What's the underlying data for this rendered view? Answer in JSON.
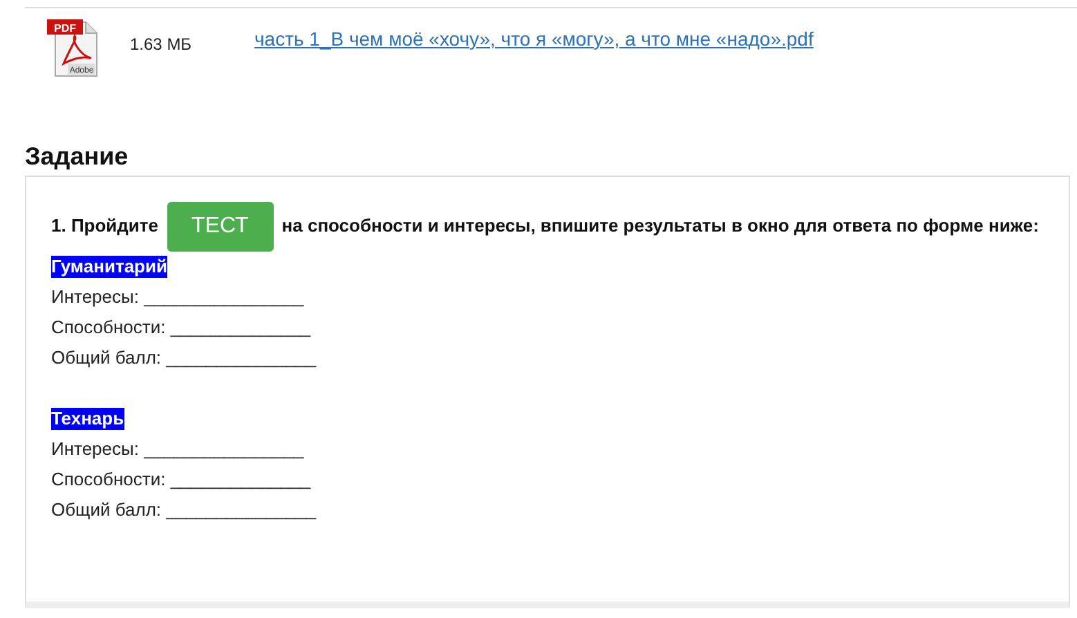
{
  "file": {
    "icon_label": "PDF",
    "icon_sublabel": "Adobe",
    "size": "1.63 МБ",
    "link": "часть 1_В чем моё «хочу», что я «могу», а что мне «надо».pdf"
  },
  "task": {
    "heading": "Задание",
    "intro_before": "1. Пройдите",
    "button": "ТЕСТ",
    "intro_after": "на способности и интересы, впишите результаты в окно для ответа по форме ниже:",
    "groups": [
      {
        "title": "Гуманитарий",
        "lines": [
          "Интересы: ________________",
          "Способности: ______________",
          "Общий балл: _______________"
        ]
      },
      {
        "title": "Технарь",
        "lines": [
          "Интересы: ________________",
          "Способности: ______________",
          "Общий балл: _______________"
        ]
      }
    ]
  }
}
